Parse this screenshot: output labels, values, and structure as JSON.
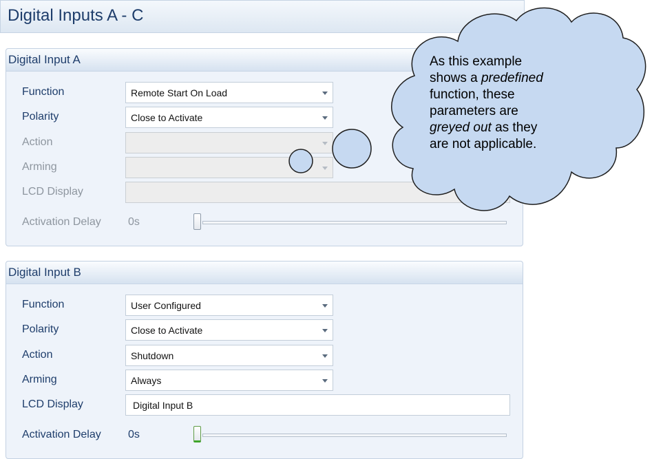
{
  "page": {
    "title": "Digital Inputs A - C"
  },
  "labels": {
    "function": "Function",
    "polarity": "Polarity",
    "action": "Action",
    "arming": "Arming",
    "lcd_display": "LCD Display",
    "activation_delay": "Activation Delay"
  },
  "input_a": {
    "header": "Digital Input A",
    "function": "Remote Start On Load",
    "polarity": "Close to Activate",
    "action": "",
    "arming": "",
    "lcd_display": "",
    "activation_delay": "0s",
    "disabled_fields": [
      "action",
      "arming",
      "lcd_display",
      "activation_delay"
    ]
  },
  "input_b": {
    "header": "Digital Input B",
    "function": "User Configured",
    "polarity": "Close to Activate",
    "action": "Shutdown",
    "arming": "Always",
    "lcd_display": "Digital Input B",
    "activation_delay": "0s"
  },
  "callout": {
    "line1": "As this example",
    "line2_pre": "shows a ",
    "line2_em": "predefined",
    "line3": "function, these",
    "line4": "parameters are",
    "line5_em": "greyed out",
    "line5_post": " as they",
    "line6": "are not applicable.",
    "fill_color": "#c6d9f1"
  },
  "colors": {
    "label_text": "#1e3d6b",
    "disabled_text": "#8e969f",
    "panel_bg": "#eef3fa",
    "slider_active": "#3fa52a"
  }
}
